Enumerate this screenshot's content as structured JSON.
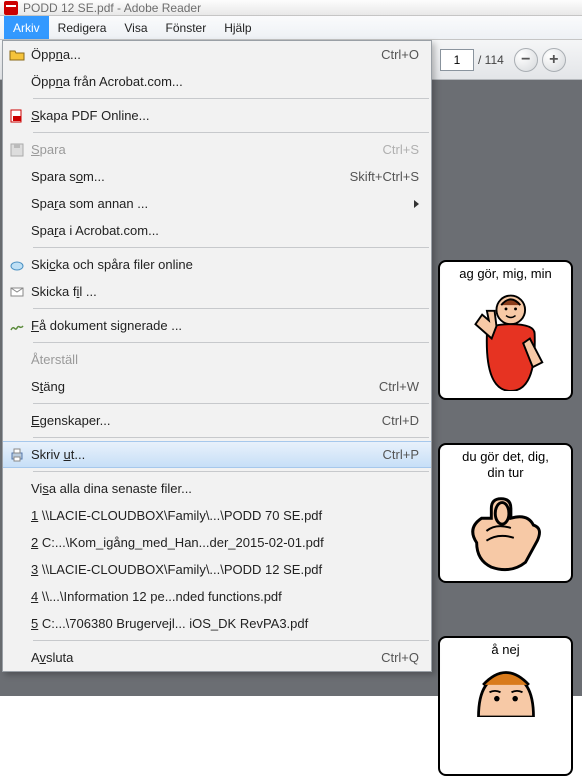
{
  "title": "PODD 12 SE.pdf - Adobe Reader",
  "menubar": {
    "file": "Arkiv",
    "edit": "Redigera",
    "view": "Visa",
    "window": "Fönster",
    "help": "Hjälp"
  },
  "toolbar": {
    "page_value": "1",
    "page_total": "/ 114"
  },
  "dropdown": {
    "open": "Öppna...",
    "open_sc": "Ctrl+O",
    "open_from_acrobat": "Öppna från Acrobat.com...",
    "create_pdf_online": "Skapa PDF Online...",
    "save": "Spara",
    "save_sc": "Ctrl+S",
    "save_as": "Spara som...",
    "save_as_sc": "Skift+Ctrl+S",
    "save_as_other": "Spara som annan ...",
    "save_in_acrobat": "Spara i Acrobat.com...",
    "send_track": "Skicka och spåra filer online",
    "send_file": "Skicka fil ...",
    "get_signed": "Få dokument signerade ...",
    "revert": "Återställ",
    "close": "Stäng",
    "close_sc": "Ctrl+W",
    "properties": "Egenskaper...",
    "properties_sc": "Ctrl+D",
    "print": "Skriv ut...",
    "print_sc": "Ctrl+P",
    "show_recent": "Visa alla dina senaste filer...",
    "recent1": "1 \\\\LACIE-CLOUDBOX\\Family\\...\\PODD 70 SE.pdf",
    "recent2": "2 C:...\\Kom_igång_med_Han...der_2015-02-01.pdf",
    "recent3": "3 \\\\LACIE-CLOUDBOX\\Family\\...\\PODD 12 SE.pdf",
    "recent4": "4 \\\\...\\Information 12 pe...nded functions.pdf",
    "recent5": "5 C:...\\706380 Brugervejl... iOS_DK RevPA3.pdf",
    "exit": "Avsluta",
    "exit_sc": "Ctrl+Q"
  },
  "cards": {
    "card1_line1": "ag gör, mig, min",
    "card2_line1": "du gör det, dig,",
    "card2_line2": "din tur",
    "card3_line1": "å nej"
  }
}
